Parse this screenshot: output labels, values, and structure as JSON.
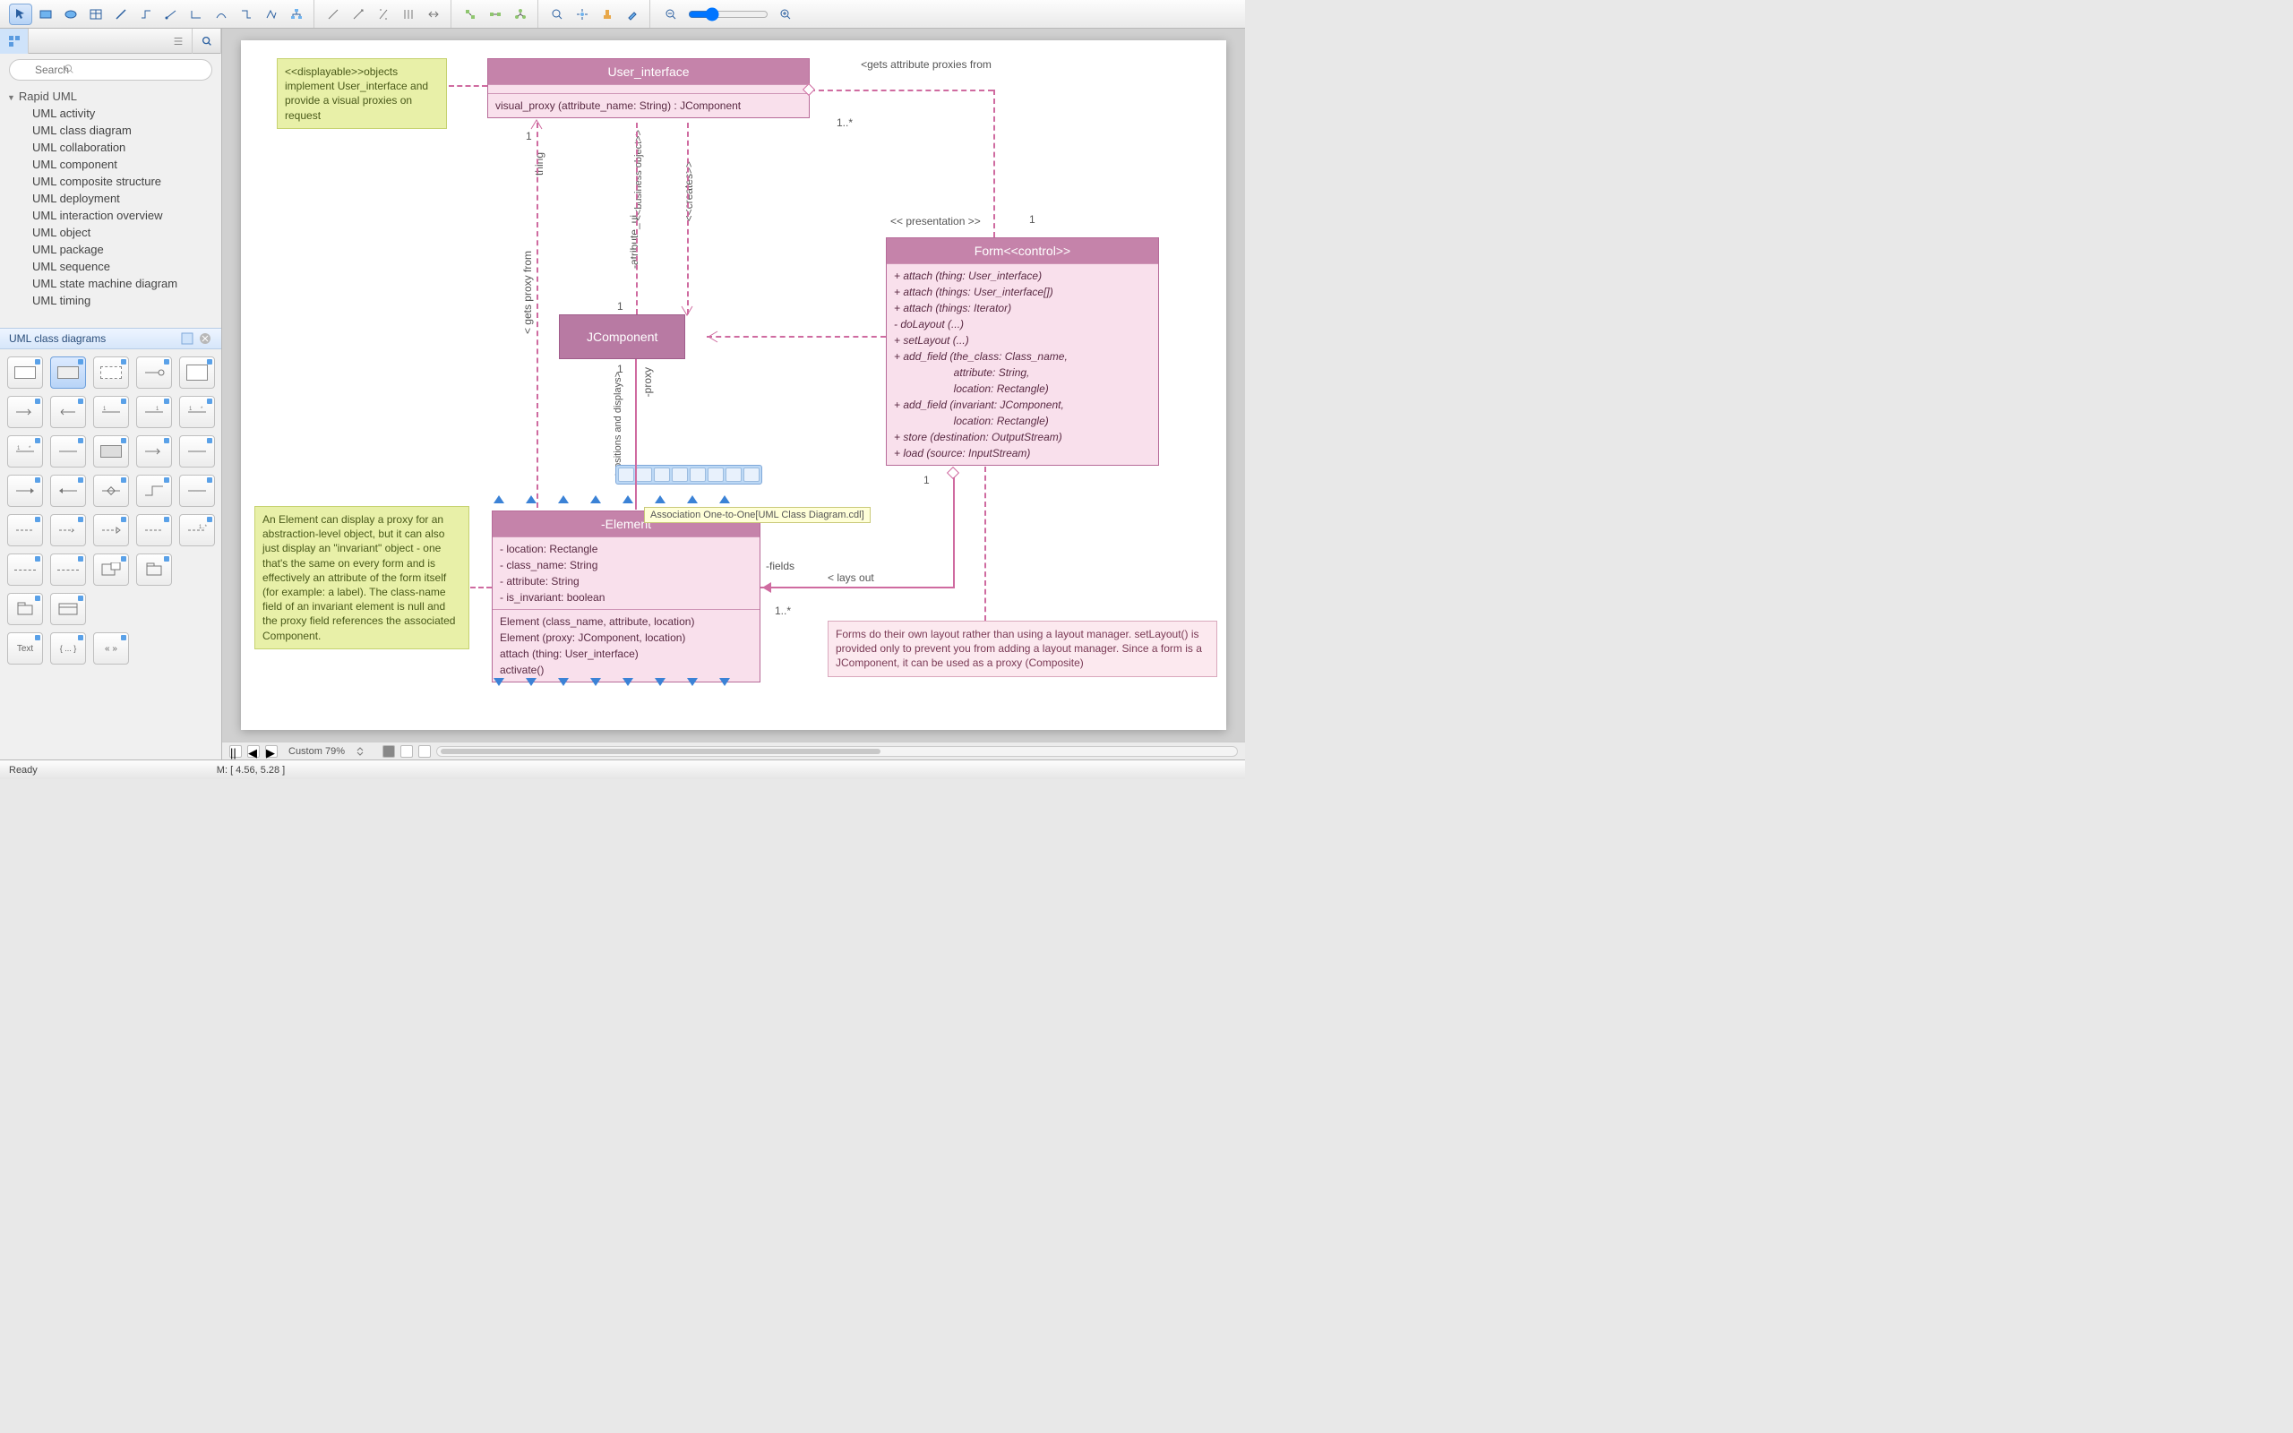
{
  "search": {
    "placeholder": "Search"
  },
  "tree": {
    "title": "Rapid UML",
    "items": [
      "UML activity",
      "UML class diagram",
      "UML collaboration",
      "UML component",
      "UML composite structure",
      "UML deployment",
      "UML interaction overview",
      "UML object",
      "UML package",
      "UML sequence",
      "UML state machine diagram",
      "UML timing"
    ]
  },
  "lib_header": "UML class diagrams",
  "palette": {
    "text_label": "Text",
    "brackets_label": "{ ... }",
    "arrows_label": "« »"
  },
  "status": {
    "ready": "Ready",
    "zoom_label": "Custom 79%",
    "mouse_label": "M: [ 4.56, 5.28 ]"
  },
  "tooltip": "Association One-to-One[UML Class Diagram.cdl]",
  "notes": {
    "displayable": "<<displayable>>objects implement User_interface and provide a visual proxies on request",
    "element": "An Element can display a proxy for an abstraction-level object, but it can also just display an \"invariant\" object - one that's the same on every form and is effectively an attribute of the form itself (for example: a label). The class-name field of an invariant element is null and the proxy field references the associated Component.",
    "form": "Forms do their own layout rather than using a layout manager. setLayout() is provided only to prevent you from adding a layout manager.\nSince a form is a JComponent, it can be used as a proxy (Composite)"
  },
  "classes": {
    "user_interface": {
      "title": "User_interface",
      "op": "visual_proxy (attribute_name: String) : JComponent"
    },
    "jcomponent": {
      "title": "JComponent"
    },
    "form": {
      "title": "Form<<control>>",
      "ops": "+ attach (thing: User_interface)\n+ attach (things: User_interface[])\n+ attach (things: Iterator)\n- doLayout (...)\n+ setLayout (...)\n+ add_field (the_class: Class_name,\n                    attribute: String,\n                    location: Rectangle)\n+ add_field (invariant: JComponent,\n                    location: Rectangle)\n+ store (destination: OutputStream)\n+ load (source: InputStream)"
    },
    "element": {
      "title": "-Element",
      "attrs": "- location: Rectangle\n- class_name: String\n- attribute: String\n- is_invariant: boolean",
      "ops": "Element (class_name, attribute, location)\nElement (proxy: JComponent, location)\nattach (thing: User_interface)\nactivate()"
    }
  },
  "labels": {
    "gets_attr": "<gets attribute proxies from",
    "mult_1s": "1..*",
    "presentation": "<< presentation >>",
    "one_a": "1",
    "gets_proxy": "< gets proxy from",
    "thing": "thing",
    "business": "<<business object>>",
    "atribute_ui": "-atribute_ui",
    "creates": "<<creates>>",
    "one_b": "1",
    "one_c": "1",
    "proxy": "-proxy",
    "positions": "<positions and displays>",
    "fields": "-fields",
    "lays_out": "< lays out",
    "mult_1s_b": "1..*",
    "one_d": "1"
  }
}
